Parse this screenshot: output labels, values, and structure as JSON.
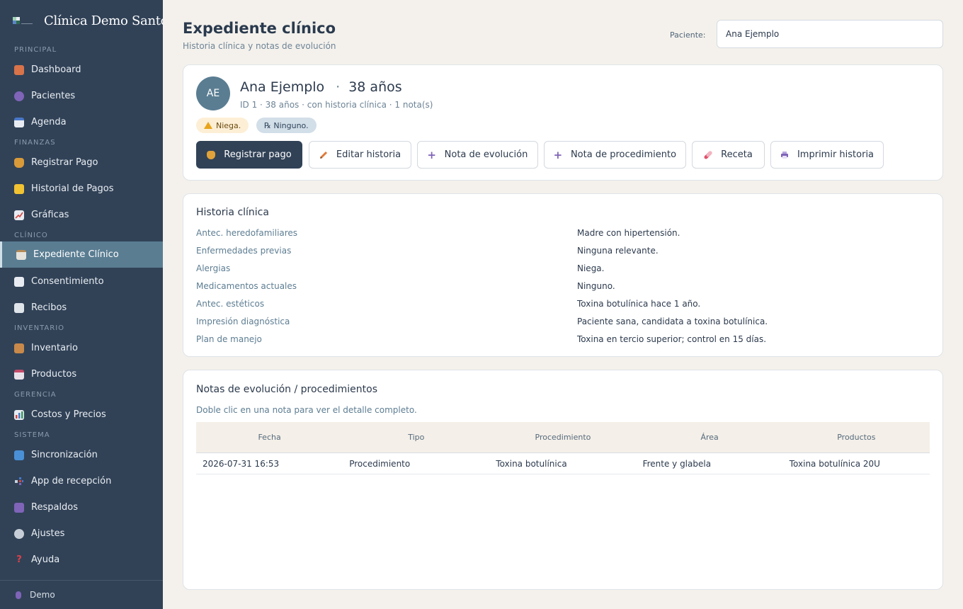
{
  "sidebar": {
    "brand": "Clínica Demo Santo",
    "sections": {
      "principal": "PRINCIPAL",
      "finanzas": "FINANZAS",
      "clinico": "CLÍNICO",
      "inventario": "INVENTARIO",
      "gerencia": "GERENCIA",
      "sistema": "SISTEMA"
    },
    "items": {
      "dashboard": "Dashboard",
      "pacientes": "Pacientes",
      "agenda": "Agenda",
      "registrar_pago": "Registrar Pago",
      "historial_pagos": "Historial de Pagos",
      "graficas": "Gráficas",
      "expediente": "Expediente Clínico",
      "consentimiento": "Consentimiento",
      "recibos": "Recibos",
      "inventario": "Inventario",
      "productos": "Productos",
      "costos": "Costos y Precios",
      "sincronizacion": "Sincronización",
      "app_recepcion": "App de recepción",
      "respaldos": "Respaldos",
      "ajustes": "Ajustes",
      "ayuda": "Ayuda"
    },
    "footer_user": "Demo"
  },
  "header": {
    "title": "Expediente clínico",
    "subtitle": "Historia clínica y notas de evolución",
    "patient_label": "Paciente:",
    "patient_value": "Ana Ejemplo"
  },
  "patient": {
    "initials": "AE",
    "name": "Ana Ejemplo",
    "separator": "·",
    "age": "38 años",
    "meta": "ID 1 · 38 años · con historia clínica · 1 nota(s)",
    "allergy_badge": "Niega.",
    "meds_badge": "℞ Ninguno."
  },
  "actions": {
    "registrar_pago": "Registrar pago",
    "editar_historia": "Editar historia",
    "nota_evolucion": "Nota de evolución",
    "nota_procedimiento": "Nota de procedimiento",
    "receta": "Receta",
    "imprimir": "Imprimir historia"
  },
  "historia": {
    "title": "Historia clínica",
    "rows": [
      {
        "label": "Antec. heredofamiliares",
        "value": "Madre con hipertensión."
      },
      {
        "label": "Enfermedades previas",
        "value": "Ninguna relevante."
      },
      {
        "label": "Alergias",
        "value": "Niega."
      },
      {
        "label": "Medicamentos actuales",
        "value": "Ninguno."
      },
      {
        "label": "Antec. estéticos",
        "value": "Toxina botulínica hace 1 año."
      },
      {
        "label": "Impresión diagnóstica",
        "value": "Paciente sana, candidata a toxina botulínica."
      },
      {
        "label": "Plan de manejo",
        "value": "Toxina en tercio superior; control en 15 días."
      }
    ]
  },
  "notas": {
    "title": "Notas de evolución / procedimientos",
    "hint": "Doble clic en una nota para ver el detalle completo.",
    "columns": [
      "Fecha",
      "Tipo",
      "Procedimiento",
      "Área",
      "Productos"
    ],
    "rows": [
      [
        "2026-07-31 16:53",
        "Procedimiento",
        "Toxina botulínica",
        "Frente y glabela",
        "Toxina botulínica 20U"
      ]
    ]
  },
  "colors": {
    "sidebar_bg": "#314257",
    "active_item": "#5a7d92",
    "primary_button": "#314257",
    "accent_purple": "#7f64b8",
    "page_bg": "#f4f1ec"
  }
}
